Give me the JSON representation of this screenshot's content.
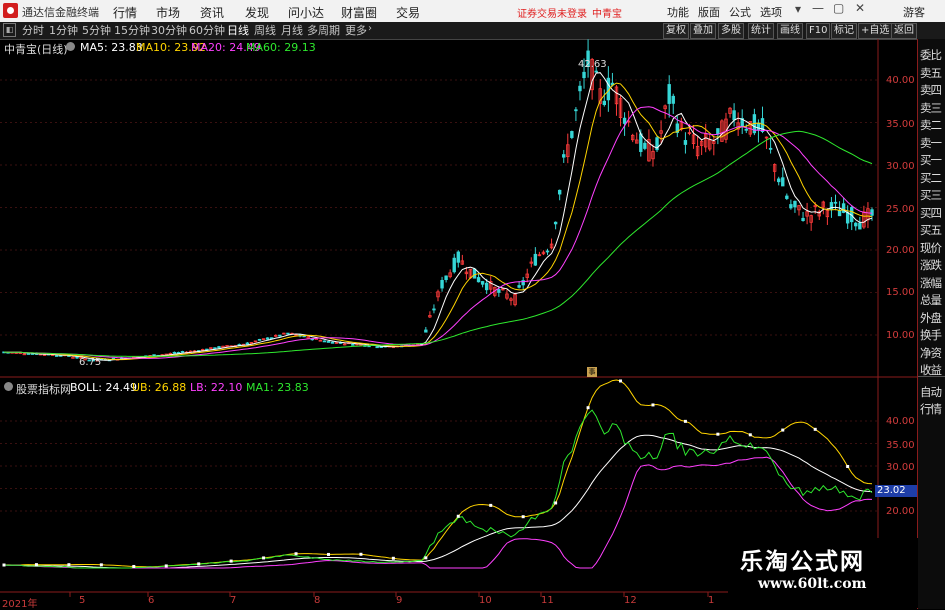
{
  "app": {
    "title": "通达信金融终端"
  },
  "menu": [
    "行情",
    "市场",
    "资讯",
    "发现",
    "问小达",
    "财富圈",
    "交易"
  ],
  "login_status": "证券交易未登录",
  "stock_tag": "中青宝",
  "right_menu": [
    "功能",
    "版面",
    "公式",
    "选项",
    "游客"
  ],
  "period_tabs": [
    "分时",
    "1分钟",
    "5分钟",
    "15分钟",
    "30分钟",
    "60分钟",
    "日线",
    "周线",
    "月线",
    "多周期",
    "更多"
  ],
  "active_period": "日线",
  "toolbar_right": [
    "复权",
    "叠加",
    "多股",
    "统计",
    "画线",
    "F10",
    "标记",
    "+自选",
    "返回"
  ],
  "main_chart": {
    "title": "中青宝(日线)",
    "ma": [
      {
        "label": "MA5: 23.83",
        "color": "#ffffff"
      },
      {
        "label": "MA10: 23.92",
        "color": "#ffd400"
      },
      {
        "label": "MA20: 24.49",
        "color": "#ff40ff"
      },
      {
        "label": "MA60: 29.13",
        "color": "#2ee82e"
      }
    ],
    "max_annotation": "42.63",
    "min_annotation": "6.75",
    "y_ticks": [
      "40.00",
      "35.00",
      "30.00",
      "25.00",
      "20.00",
      "15.00",
      "10.00"
    ]
  },
  "sub_chart": {
    "indicator": "股票指标网",
    "legend": [
      {
        "label": "BOLL: 24.49",
        "color": "#ffffff"
      },
      {
        "label": "UB: 26.88",
        "color": "#ffd400"
      },
      {
        "label": "LB: 22.10",
        "color": "#ff40ff"
      },
      {
        "label": "MA1: 23.83",
        "color": "#2ee82e"
      }
    ],
    "y_ticks": [
      "40.00",
      "35.00",
      "30.00",
      "25.00",
      "20.00"
    ],
    "current_value": "23.02"
  },
  "date_labels": [
    "2021年",
    "5",
    "6",
    "7",
    "8",
    "9",
    "10",
    "11",
    "12",
    "1"
  ],
  "side_panel": [
    "委比",
    "卖五",
    "卖四",
    "卖三",
    "卖二",
    "卖一",
    "买一",
    "买二",
    "买三",
    "买四",
    "买五",
    "现价",
    "涨跌",
    "涨幅",
    "总量",
    "外盘",
    "换手",
    "净资",
    "收益"
  ],
  "side_panel_bottom": [
    "自动",
    "行情"
  ],
  "watermark": {
    "text": "乐淘公式网",
    "url": "www.60lt.com"
  },
  "colors": {
    "up": "#ff3b3b",
    "down": "#36d6d6",
    "accent": "#d21e1e",
    "axis": "#8a1c1c"
  }
}
